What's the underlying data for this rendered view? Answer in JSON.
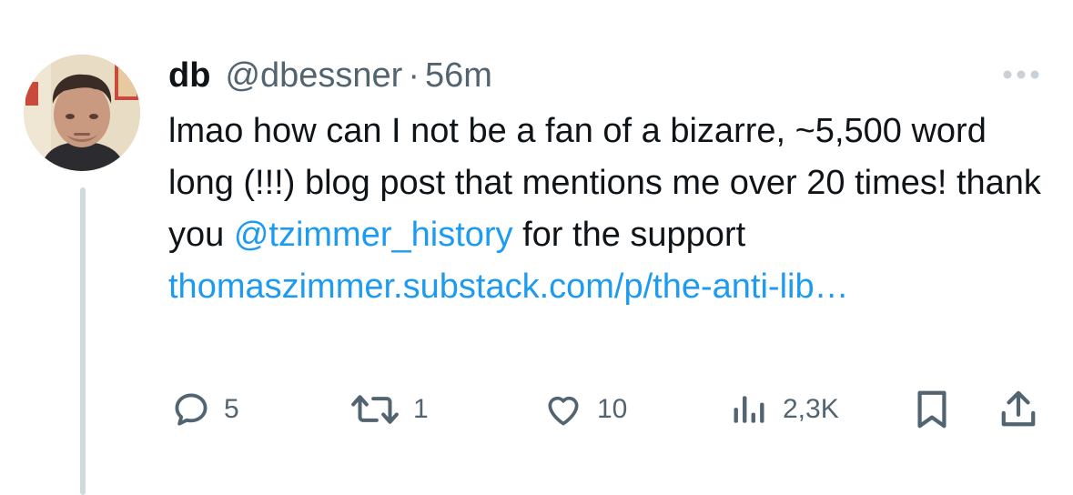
{
  "tweet": {
    "author_name": "db",
    "author_handle": "@dbessner",
    "separator": "·",
    "time_ago": "56m",
    "text_plain": "lmao how can I not be a  fan of a bizarre, ~5,500 word long (!!!) blog post that mentions me over 20 times! thank you ",
    "mention": "@tzimmer_history",
    "text_after_mention": " for the support ",
    "link_text": "thomaszimmer.substack.com/p/the-anti-lib…"
  },
  "actions": {
    "replies": "5",
    "retweets": "1",
    "likes": "10",
    "views": "2,3K"
  },
  "icons": {
    "more": "more-horizontal-icon",
    "reply": "reply-icon",
    "retweet": "retweet-icon",
    "like": "heart-icon",
    "views": "views-icon",
    "bookmark": "bookmark-icon",
    "share": "share-icon"
  },
  "colors": {
    "text": "#0f1419",
    "secondary": "#536471",
    "link": "#1d9bf0",
    "thread_line": "#cfd9de"
  }
}
